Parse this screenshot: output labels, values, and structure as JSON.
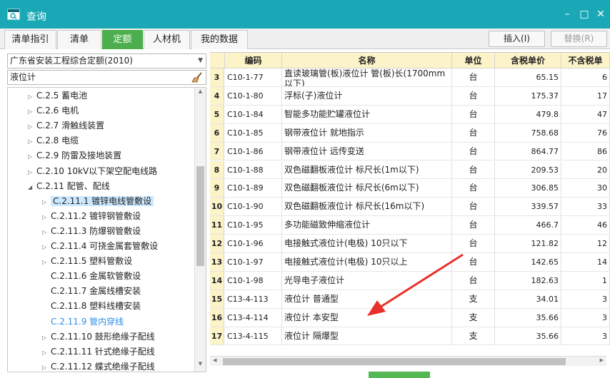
{
  "window": {
    "title": "查询",
    "min_symbol": "–",
    "max_symbol": "□",
    "close_symbol": "✕"
  },
  "tabs": [
    {
      "label": "清单指引"
    },
    {
      "label": "清单"
    },
    {
      "label": "定额",
      "active": true
    },
    {
      "label": "人材机"
    },
    {
      "label": "我的数据"
    }
  ],
  "toolbar": {
    "insert_label": "插入(I)",
    "replace_label": "替换(R)"
  },
  "left_panel": {
    "library": "广东省安装工程综合定额(2010)",
    "search_value": "液位计",
    "tree": [
      {
        "label": "C.2.5 蓄电池",
        "expander": "▷"
      },
      {
        "label": "C.2.6 电机",
        "expander": "▷"
      },
      {
        "label": "C.2.7 滑触线装置",
        "expander": "▷"
      },
      {
        "label": "C.2.8 电缆",
        "expander": "▷"
      },
      {
        "label": "C.2.9 防雷及接地装置",
        "expander": "▷"
      },
      {
        "label": "C.2.10 10kV以下架空配电线路",
        "expander": "▷"
      },
      {
        "label": "C.2.11 配管、配线",
        "expander": "◢"
      },
      {
        "label": "C.2.11.1 镀锌电线管敷设",
        "expander": "▷",
        "selected": true
      },
      {
        "label": "C.2.11.2 镀锌钢管敷设",
        "expander": "▷"
      },
      {
        "label": "C.2.11.3 防爆钢管敷设",
        "expander": "▷"
      },
      {
        "label": "C.2.11.4 可挠金属套管敷设",
        "expander": "▷"
      },
      {
        "label": "C.2.11.5 塑料管敷设",
        "expander": "▷"
      },
      {
        "label": "C.2.11.6 金属软管敷设",
        "expander": ""
      },
      {
        "label": "C.2.11.7 金属线槽安装",
        "expander": ""
      },
      {
        "label": "C.2.11.8 塑料线槽安装",
        "expander": ""
      },
      {
        "label": "C.2.11.9 管内穿线",
        "expander": "",
        "highlight": true
      },
      {
        "label": "C.2.11.10 鼓形绝缘子配线",
        "expander": "▷"
      },
      {
        "label": "C.2.11.11 针式绝缘子配线",
        "expander": "▷"
      },
      {
        "label": "C.2.11.12 蝶式绝缘子配线",
        "expander": "▷"
      }
    ]
  },
  "table": {
    "columns": [
      "编码",
      "名称",
      "单位",
      "含税单价",
      "不含税单"
    ],
    "rows": [
      {
        "no": "3",
        "code": "C10-1-77",
        "name": "直读玻璃管(板)液位计 管(板)长(1700mm以下)",
        "unit": "台",
        "price": "65.15",
        "price_ex": "6"
      },
      {
        "no": "4",
        "code": "C10-1-80",
        "name": "浮标(子)液位计",
        "unit": "台",
        "price": "175.37",
        "price_ex": "17"
      },
      {
        "no": "5",
        "code": "C10-1-84",
        "name": "智能多功能贮罐液位计",
        "unit": "台",
        "price": "479.8",
        "price_ex": "47"
      },
      {
        "no": "6",
        "code": "C10-1-85",
        "name": "钢带液位计 就地指示",
        "unit": "台",
        "price": "758.68",
        "price_ex": "76"
      },
      {
        "no": "7",
        "code": "C10-1-86",
        "name": "钢带液位计 远传变送",
        "unit": "台",
        "price": "864.77",
        "price_ex": "86"
      },
      {
        "no": "8",
        "code": "C10-1-88",
        "name": "双色磁翻板液位计 标尺长(1m以下)",
        "unit": "台",
        "price": "209.53",
        "price_ex": "20"
      },
      {
        "no": "9",
        "code": "C10-1-89",
        "name": "双色磁翻板液位计 标尺长(6m以下)",
        "unit": "台",
        "price": "306.85",
        "price_ex": "30"
      },
      {
        "no": "10",
        "code": "C10-1-90",
        "name": "双色磁翻板液位计 标尺长(16m以下)",
        "unit": "台",
        "price": "339.57",
        "price_ex": "33"
      },
      {
        "no": "11",
        "code": "C10-1-95",
        "name": "多功能磁致伸缩液位计",
        "unit": "台",
        "price": "466.7",
        "price_ex": "46"
      },
      {
        "no": "12",
        "code": "C10-1-96",
        "name": "电接触式液位计(电极) 10只以下",
        "unit": "台",
        "price": "121.82",
        "price_ex": "12"
      },
      {
        "no": "13",
        "code": "C10-1-97",
        "name": "电接触式液位计(电极) 10只以上",
        "unit": "台",
        "price": "142.65",
        "price_ex": "14"
      },
      {
        "no": "14",
        "code": "C10-1-98",
        "name": "光导电子液位计",
        "unit": "台",
        "price": "182.63",
        "price_ex": "1"
      },
      {
        "no": "15",
        "code": "C13-4-113",
        "name": "液位计 普通型",
        "unit": "支",
        "price": "34.01",
        "price_ex": "3"
      },
      {
        "no": "16",
        "code": "C13-4-114",
        "name": "液位计 本安型",
        "unit": "支",
        "price": "35.66",
        "price_ex": "3"
      },
      {
        "no": "17",
        "code": "C13-4-115",
        "name": "液位计 隔爆型",
        "unit": "支",
        "price": "35.66",
        "price_ex": "3"
      }
    ]
  },
  "colors": {
    "titlebar": "#1aa8b6",
    "active_tab": "#4cae4c",
    "header_bg": "#fdf3c8",
    "selection": "#cce8ff",
    "annotation_arrow": "#e8302a"
  },
  "icons": {
    "app": "window-icon",
    "search_clear": "broom-icon",
    "expander_collapsed": "triangle-right-icon",
    "expander_expanded": "triangle-down-icon"
  }
}
